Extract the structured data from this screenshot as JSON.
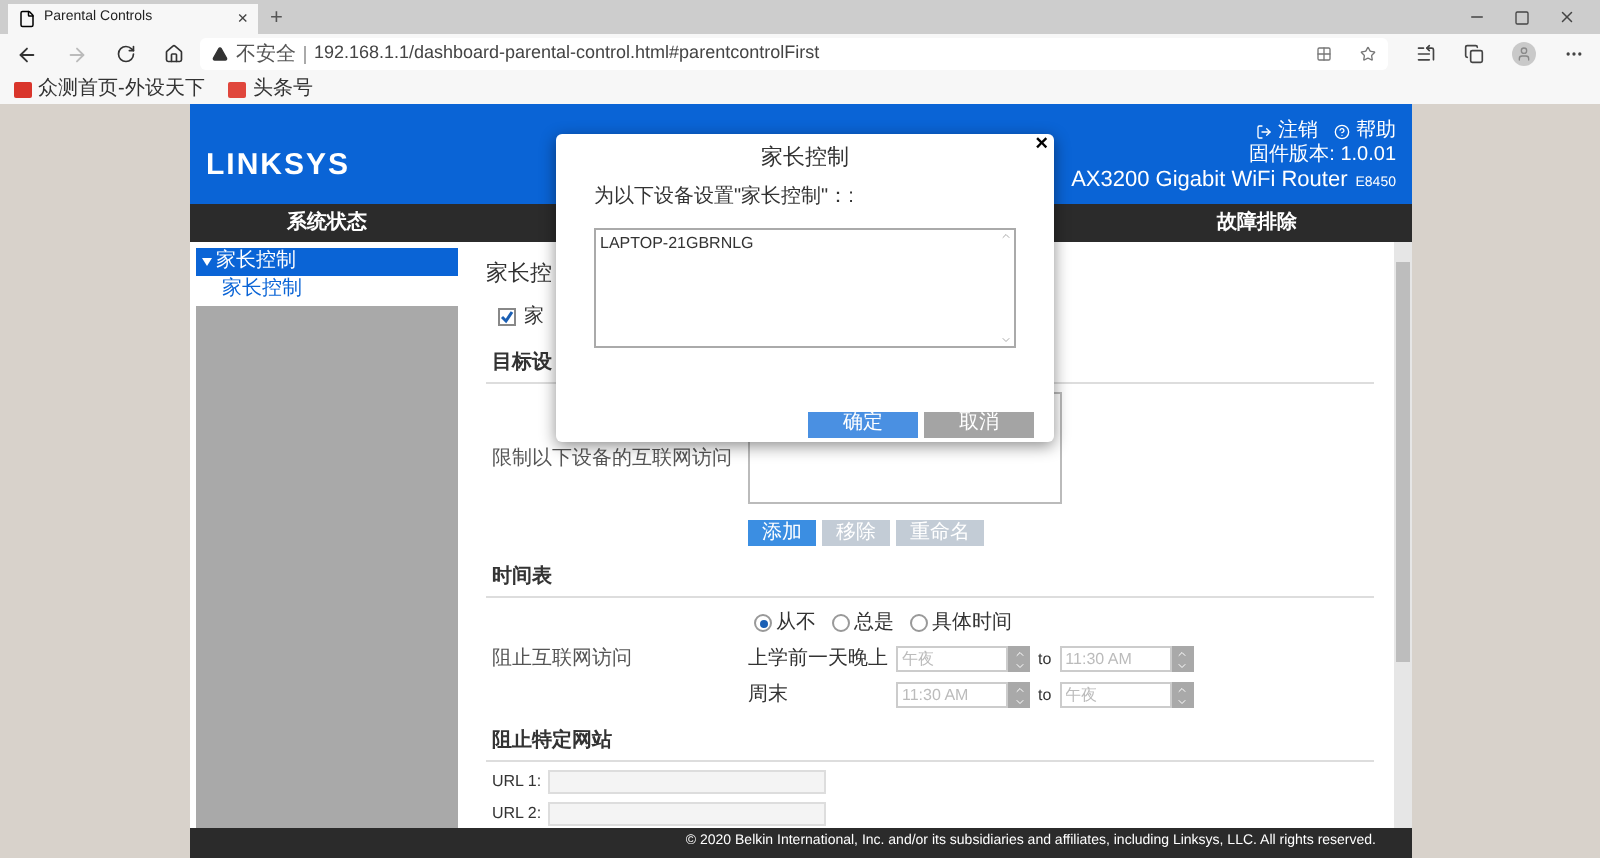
{
  "browser": {
    "tab": {
      "title": "Parental Controls",
      "close": "×"
    },
    "new_tab": "+",
    "address": {
      "security": "不安全",
      "url": "192.168.1.1/dashboard-parental-control.html#parentcontrolFirst"
    },
    "bookmarks": [
      {
        "label": "众测首页-外设天下",
        "color": "#d9352b"
      },
      {
        "label": "头条号",
        "color": "#e0463c"
      }
    ]
  },
  "router": {
    "logo": "LINKSYS",
    "links": [
      {
        "label": "注销",
        "kind": "logout"
      },
      {
        "label": "帮助",
        "kind": "help"
      }
    ],
    "firmware": "固件版本: 1.0.01",
    "model": "AX3200 Gigabit WiFi Router",
    "model_code": "E8450",
    "nav": [
      {
        "label": "系统状态"
      },
      {
        "label": "故障排除"
      }
    ],
    "sidebar": [
      {
        "label": "家长控制",
        "expanded": true,
        "selected": true,
        "children": [
          {
            "label": "家长控制",
            "selected": false
          }
        ]
      }
    ],
    "content": {
      "title": "家长控",
      "enable": {
        "label": "家",
        "checked": true
      },
      "target_section": {
        "title": "目标设",
        "row_label": "限制以下设备的互联网访问",
        "buttons": [
          {
            "label": "添加",
            "disabled": false
          },
          {
            "label": "移除",
            "disabled": true
          },
          {
            "label": "重命名",
            "disabled": true
          }
        ]
      },
      "schedule_section": {
        "title": "时间表",
        "row_label": "阻止互联网访问",
        "options": [
          {
            "label": "从不",
            "selected": true
          },
          {
            "label": "总是",
            "selected": false
          },
          {
            "label": "具体时间",
            "selected": false
          }
        ],
        "rows": [
          {
            "label": "上学前一天晚上",
            "from": "午夜",
            "to_word": "to",
            "to": "11:30 AM",
            "disabled": true
          },
          {
            "label": "周末",
            "from": "11:30 AM",
            "to_word": "to",
            "to": "午夜",
            "disabled": true
          }
        ]
      },
      "sites_section": {
        "title": "阻止特定网站",
        "urls": [
          {
            "label": "URL 1:"
          },
          {
            "label": "URL 2:"
          }
        ]
      }
    },
    "footer": "© 2020 Belkin International, Inc. and/or its subsidiaries and affiliates, including Linksys, LLC. All rights reserved."
  },
  "dialog": {
    "title": "家长控制",
    "close": "×",
    "prompt": "为以下设备设置\"家长控制\"：:",
    "devices": "LAPTOP-21GBRNLG",
    "buttons": [
      {
        "label": "确定",
        "kind": "primary"
      },
      {
        "label": "取消",
        "kind": "secondary"
      }
    ]
  }
}
